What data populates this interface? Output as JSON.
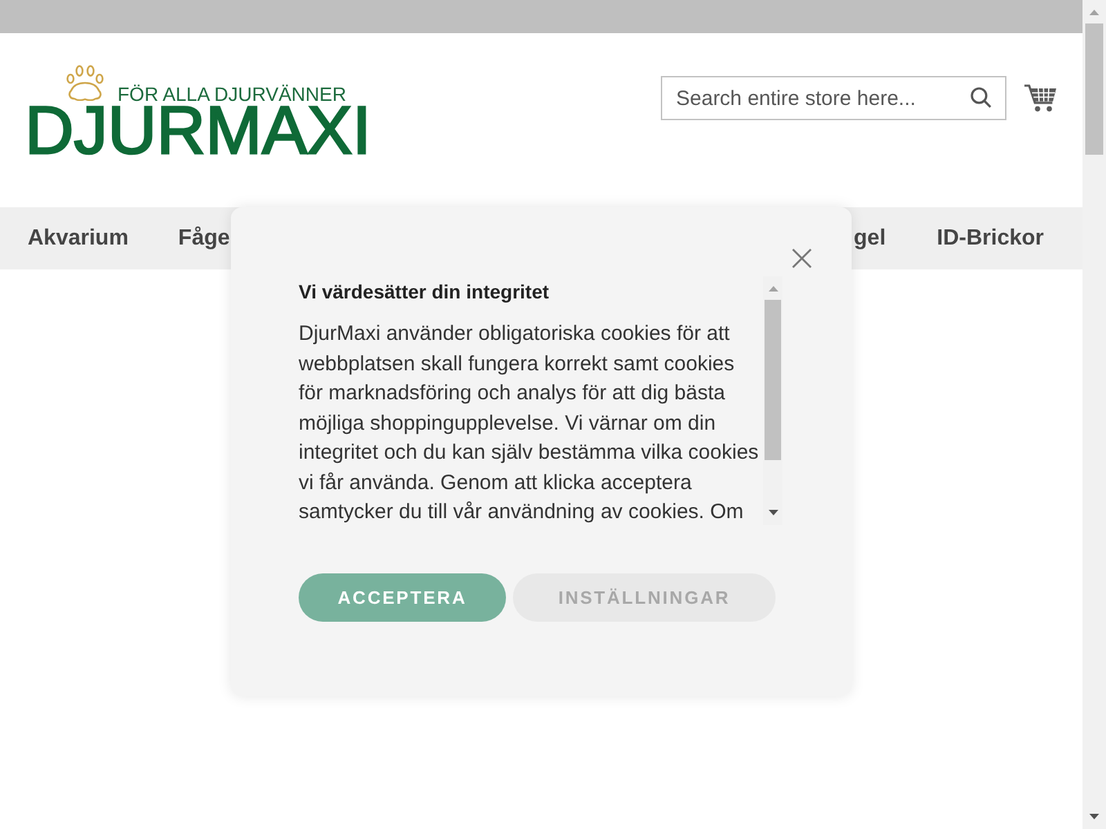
{
  "header": {
    "logo": {
      "tagline": "FÖR ALLA DJURVÄNNER",
      "wordmark": "DJURMAXI"
    },
    "search": {
      "placeholder": "Search entire store here..."
    }
  },
  "nav": {
    "items": [
      {
        "label": "Akvarium"
      },
      {
        "label": "Fåge"
      },
      {
        "label": "gel"
      },
      {
        "label": "ID-Brickor"
      }
    ]
  },
  "cookie_dialog": {
    "title": "Vi värdesätter din integritet",
    "body": "DjurMaxi använder obligatoriska cookies för att webbplatsen skall fungera korrekt samt cookies för marknadsföring och analys för att dig bästa möjliga shoppingupplevelse. Vi värnar om din integritet och du kan själv bestämma vilka cookies vi får använda. Genom att klicka acceptera samtycker du till vår användning av cookies. Om",
    "buttons": [
      {
        "label": "ACCEPTERA",
        "kind": "primary"
      },
      {
        "label": "INSTÄLLNINGAR",
        "kind": "secondary"
      }
    ]
  }
}
